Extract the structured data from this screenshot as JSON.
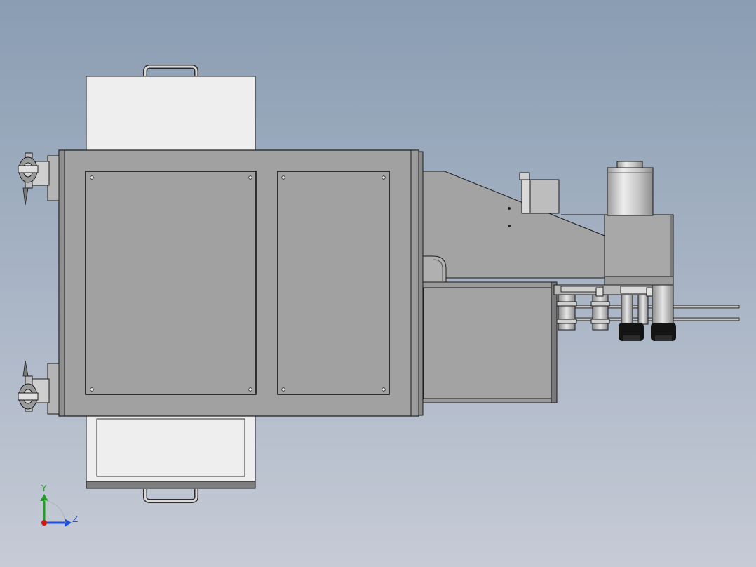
{
  "view": {
    "background_top": "#8a9db3",
    "background_bottom": "#c6cbd6"
  },
  "colors": {
    "panel_light": "#eeeeee",
    "body_gray": "#a1a1a1",
    "body_dark": "#8e8e8e",
    "outline": "#1a1a1a",
    "metal_light": "#d8d8d8",
    "metal_mid": "#b5b5b5",
    "black_part": "#141414"
  },
  "triad": {
    "y_label": "Y",
    "z_label": "Z",
    "y_color": "#1fa01f",
    "z_color": "#1e4fd8",
    "x_color": "#d01818"
  },
  "parts": {
    "handle_icon": "u-handle-icon",
    "caster_icon": "caster-wheel-icon",
    "screw_icon": "screw-dot-icon"
  }
}
